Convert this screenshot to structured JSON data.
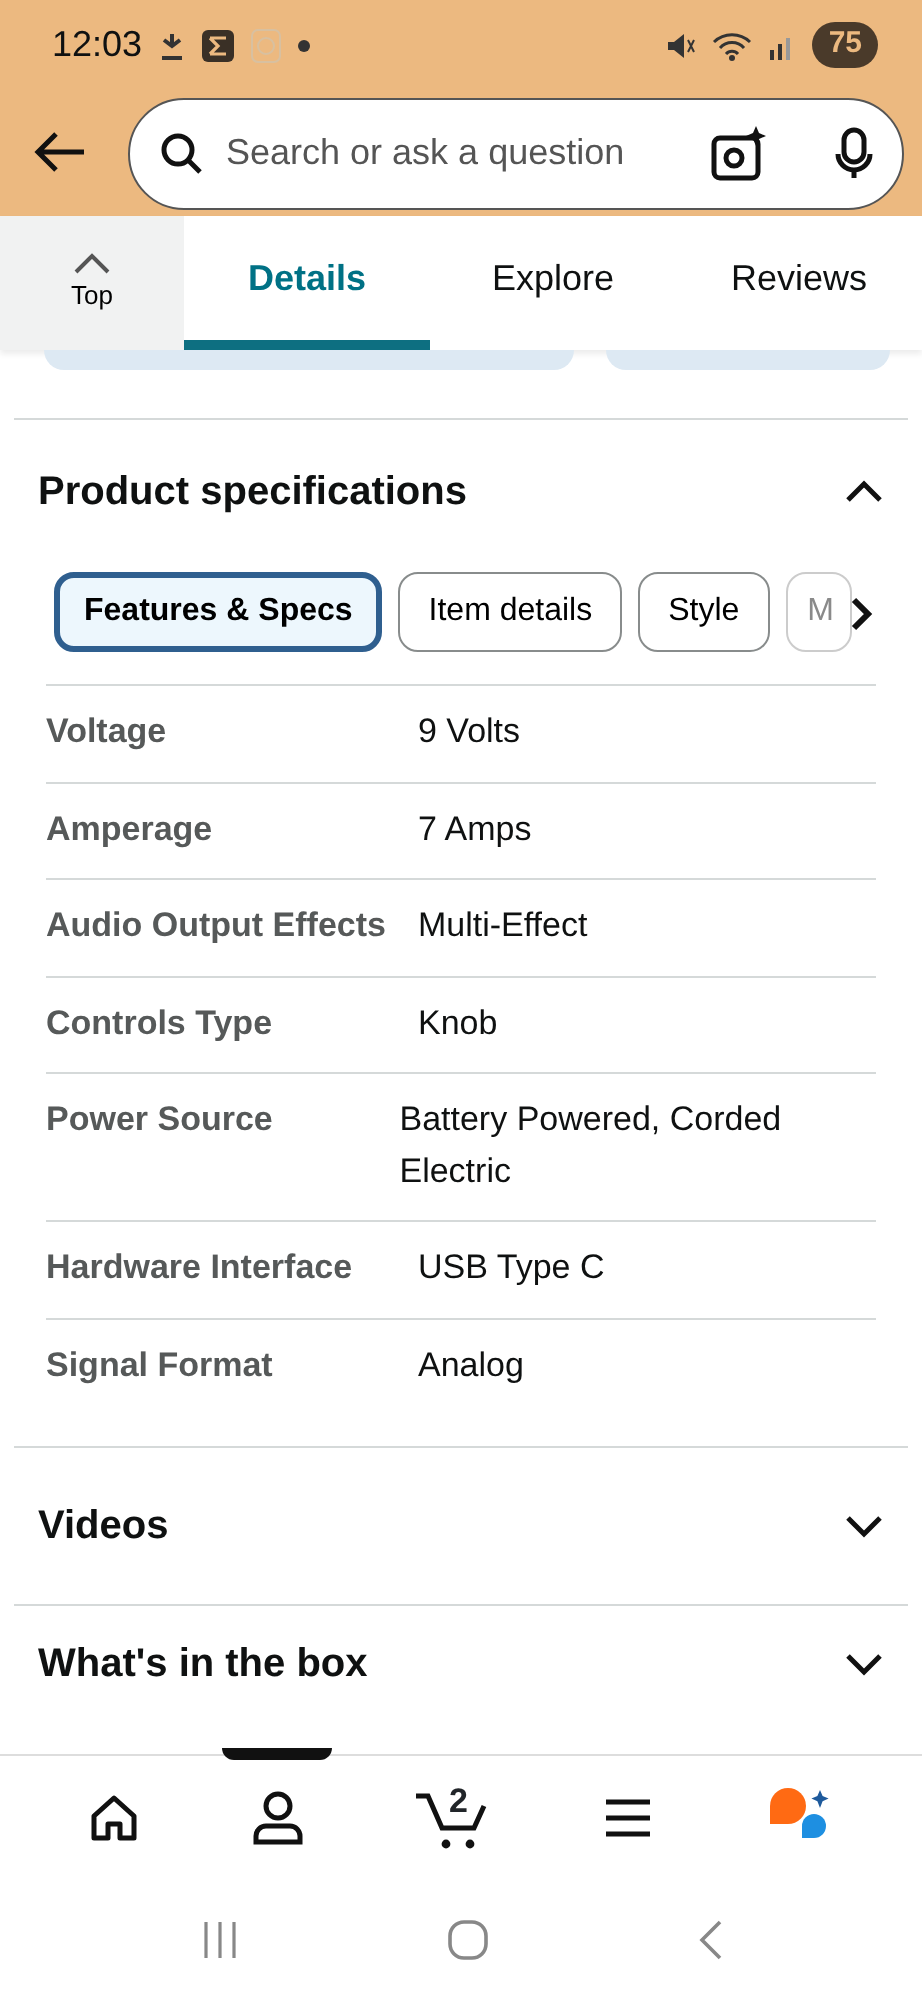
{
  "status_bar": {
    "time": "12:03",
    "battery": "75"
  },
  "search": {
    "placeholder": "Search or ask a question"
  },
  "top_button": {
    "label": "Top"
  },
  "tabs": [
    {
      "label": "Details",
      "selected": true
    },
    {
      "label": "Explore",
      "selected": false
    },
    {
      "label": "Reviews",
      "selected": false
    }
  ],
  "sections": [
    {
      "title": "Product specifications",
      "expanded": true,
      "chips": [
        {
          "label": "Features & Specs",
          "selected": true
        },
        {
          "label": "Item details",
          "selected": false
        },
        {
          "label": "Style",
          "selected": false
        },
        {
          "label": "M",
          "selected": false
        }
      ],
      "specs": [
        {
          "name": "Voltage",
          "value": "9 Volts"
        },
        {
          "name": "Amperage",
          "value": "7 Amps"
        },
        {
          "name": "Audio Output Effects",
          "value": "Multi-Effect"
        },
        {
          "name": "Controls Type",
          "value": "Knob"
        },
        {
          "name": "Power Source",
          "value": "Battery Powered, Corded Electric"
        },
        {
          "name": "Hardware Interface",
          "value": "USB Type C"
        },
        {
          "name": "Signal Format",
          "value": "Analog"
        }
      ]
    },
    {
      "title": "Videos",
      "expanded": false
    },
    {
      "title": "What's in the box",
      "expanded": false
    }
  ],
  "bottom_nav": {
    "cart_count": "2"
  }
}
